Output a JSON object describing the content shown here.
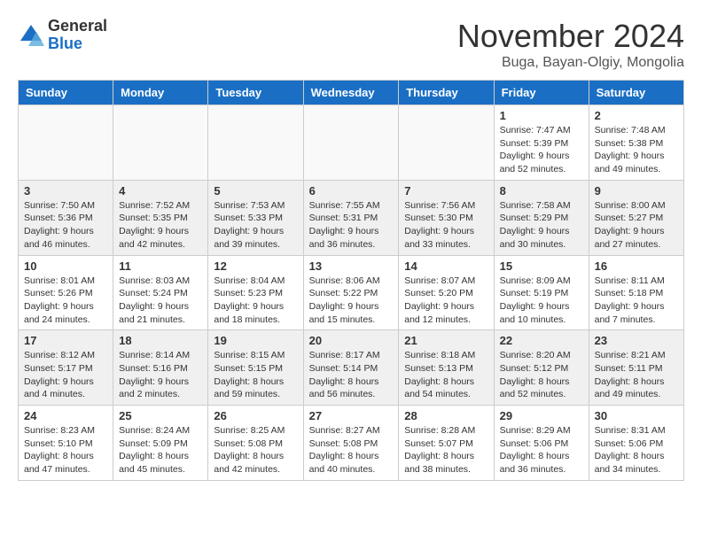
{
  "header": {
    "logo_general": "General",
    "logo_blue": "Blue",
    "month_title": "November 2024",
    "location": "Buga, Bayan-Olgiy, Mongolia"
  },
  "weekdays": [
    "Sunday",
    "Monday",
    "Tuesday",
    "Wednesday",
    "Thursday",
    "Friday",
    "Saturday"
  ],
  "weeks": [
    [
      {
        "day": "",
        "info": ""
      },
      {
        "day": "",
        "info": ""
      },
      {
        "day": "",
        "info": ""
      },
      {
        "day": "",
        "info": ""
      },
      {
        "day": "",
        "info": ""
      },
      {
        "day": "1",
        "info": "Sunrise: 7:47 AM\nSunset: 5:39 PM\nDaylight: 9 hours and 52 minutes."
      },
      {
        "day": "2",
        "info": "Sunrise: 7:48 AM\nSunset: 5:38 PM\nDaylight: 9 hours and 49 minutes."
      }
    ],
    [
      {
        "day": "3",
        "info": "Sunrise: 7:50 AM\nSunset: 5:36 PM\nDaylight: 9 hours and 46 minutes."
      },
      {
        "day": "4",
        "info": "Sunrise: 7:52 AM\nSunset: 5:35 PM\nDaylight: 9 hours and 42 minutes."
      },
      {
        "day": "5",
        "info": "Sunrise: 7:53 AM\nSunset: 5:33 PM\nDaylight: 9 hours and 39 minutes."
      },
      {
        "day": "6",
        "info": "Sunrise: 7:55 AM\nSunset: 5:31 PM\nDaylight: 9 hours and 36 minutes."
      },
      {
        "day": "7",
        "info": "Sunrise: 7:56 AM\nSunset: 5:30 PM\nDaylight: 9 hours and 33 minutes."
      },
      {
        "day": "8",
        "info": "Sunrise: 7:58 AM\nSunset: 5:29 PM\nDaylight: 9 hours and 30 minutes."
      },
      {
        "day": "9",
        "info": "Sunrise: 8:00 AM\nSunset: 5:27 PM\nDaylight: 9 hours and 27 minutes."
      }
    ],
    [
      {
        "day": "10",
        "info": "Sunrise: 8:01 AM\nSunset: 5:26 PM\nDaylight: 9 hours and 24 minutes."
      },
      {
        "day": "11",
        "info": "Sunrise: 8:03 AM\nSunset: 5:24 PM\nDaylight: 9 hours and 21 minutes."
      },
      {
        "day": "12",
        "info": "Sunrise: 8:04 AM\nSunset: 5:23 PM\nDaylight: 9 hours and 18 minutes."
      },
      {
        "day": "13",
        "info": "Sunrise: 8:06 AM\nSunset: 5:22 PM\nDaylight: 9 hours and 15 minutes."
      },
      {
        "day": "14",
        "info": "Sunrise: 8:07 AM\nSunset: 5:20 PM\nDaylight: 9 hours and 12 minutes."
      },
      {
        "day": "15",
        "info": "Sunrise: 8:09 AM\nSunset: 5:19 PM\nDaylight: 9 hours and 10 minutes."
      },
      {
        "day": "16",
        "info": "Sunrise: 8:11 AM\nSunset: 5:18 PM\nDaylight: 9 hours and 7 minutes."
      }
    ],
    [
      {
        "day": "17",
        "info": "Sunrise: 8:12 AM\nSunset: 5:17 PM\nDaylight: 9 hours and 4 minutes."
      },
      {
        "day": "18",
        "info": "Sunrise: 8:14 AM\nSunset: 5:16 PM\nDaylight: 9 hours and 2 minutes."
      },
      {
        "day": "19",
        "info": "Sunrise: 8:15 AM\nSunset: 5:15 PM\nDaylight: 8 hours and 59 minutes."
      },
      {
        "day": "20",
        "info": "Sunrise: 8:17 AM\nSunset: 5:14 PM\nDaylight: 8 hours and 56 minutes."
      },
      {
        "day": "21",
        "info": "Sunrise: 8:18 AM\nSunset: 5:13 PM\nDaylight: 8 hours and 54 minutes."
      },
      {
        "day": "22",
        "info": "Sunrise: 8:20 AM\nSunset: 5:12 PM\nDaylight: 8 hours and 52 minutes."
      },
      {
        "day": "23",
        "info": "Sunrise: 8:21 AM\nSunset: 5:11 PM\nDaylight: 8 hours and 49 minutes."
      }
    ],
    [
      {
        "day": "24",
        "info": "Sunrise: 8:23 AM\nSunset: 5:10 PM\nDaylight: 8 hours and 47 minutes."
      },
      {
        "day": "25",
        "info": "Sunrise: 8:24 AM\nSunset: 5:09 PM\nDaylight: 8 hours and 45 minutes."
      },
      {
        "day": "26",
        "info": "Sunrise: 8:25 AM\nSunset: 5:08 PM\nDaylight: 8 hours and 42 minutes."
      },
      {
        "day": "27",
        "info": "Sunrise: 8:27 AM\nSunset: 5:08 PM\nDaylight: 8 hours and 40 minutes."
      },
      {
        "day": "28",
        "info": "Sunrise: 8:28 AM\nSunset: 5:07 PM\nDaylight: 8 hours and 38 minutes."
      },
      {
        "day": "29",
        "info": "Sunrise: 8:29 AM\nSunset: 5:06 PM\nDaylight: 8 hours and 36 minutes."
      },
      {
        "day": "30",
        "info": "Sunrise: 8:31 AM\nSunset: 5:06 PM\nDaylight: 8 hours and 34 minutes."
      }
    ]
  ]
}
